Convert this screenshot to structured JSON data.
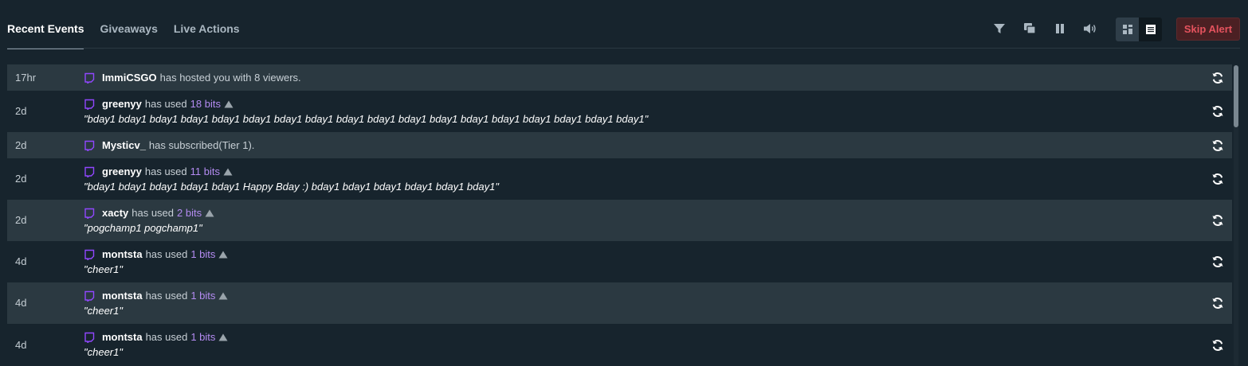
{
  "tabs": [
    {
      "label": "Recent Events",
      "active": true
    },
    {
      "label": "Giveaways",
      "active": false
    },
    {
      "label": "Live Actions",
      "active": false
    }
  ],
  "toolbar": {
    "icons": [
      "filter-icon",
      "popout-icon",
      "pause-icon",
      "volume-icon",
      "compact-view-icon",
      "list-view-icon"
    ],
    "skip_label": "Skip Alert"
  },
  "events": [
    {
      "time": "17hr",
      "user": "ImmiCSGO",
      "action": "has hosted you with 8 viewers.",
      "bits": "",
      "message": ""
    },
    {
      "time": "2d",
      "user": "greenyy",
      "action": "has used",
      "bits": "18 bits",
      "message": "\"bday1 bday1 bday1 bday1 bday1 bday1 bday1 bday1 bday1 bday1 bday1 bday1 bday1 bday1 bday1 bday1 bday1 bday1\""
    },
    {
      "time": "2d",
      "user": "Mysticv_",
      "action": "has subscribed(Tier 1).",
      "bits": "",
      "message": ""
    },
    {
      "time": "2d",
      "user": "greenyy",
      "action": "has used",
      "bits": "11 bits",
      "message": "\"bday1 bday1 bday1 bday1 bday1 Happy Bday :) bday1 bday1 bday1 bday1 bday1 bday1\""
    },
    {
      "time": "2d",
      "user": "xacty",
      "action": "has used",
      "bits": "2 bits",
      "message": "\"pogchamp1 pogchamp1\""
    },
    {
      "time": "4d",
      "user": "montsta",
      "action": "has used",
      "bits": "1 bits",
      "message": "\"cheer1\""
    },
    {
      "time": "4d",
      "user": "montsta",
      "action": "has used",
      "bits": "1 bits",
      "message": "\"cheer1\""
    },
    {
      "time": "4d",
      "user": "montsta",
      "action": "has used",
      "bits": "1 bits",
      "message": "\"cheer1\""
    }
  ],
  "colors": {
    "background": "#17242d",
    "row_alt": "#2b3941",
    "bits": "#b48bf2",
    "twitch": "#9147ff",
    "skip_text": "#e5535e",
    "skip_bg": "#4b2023"
  }
}
